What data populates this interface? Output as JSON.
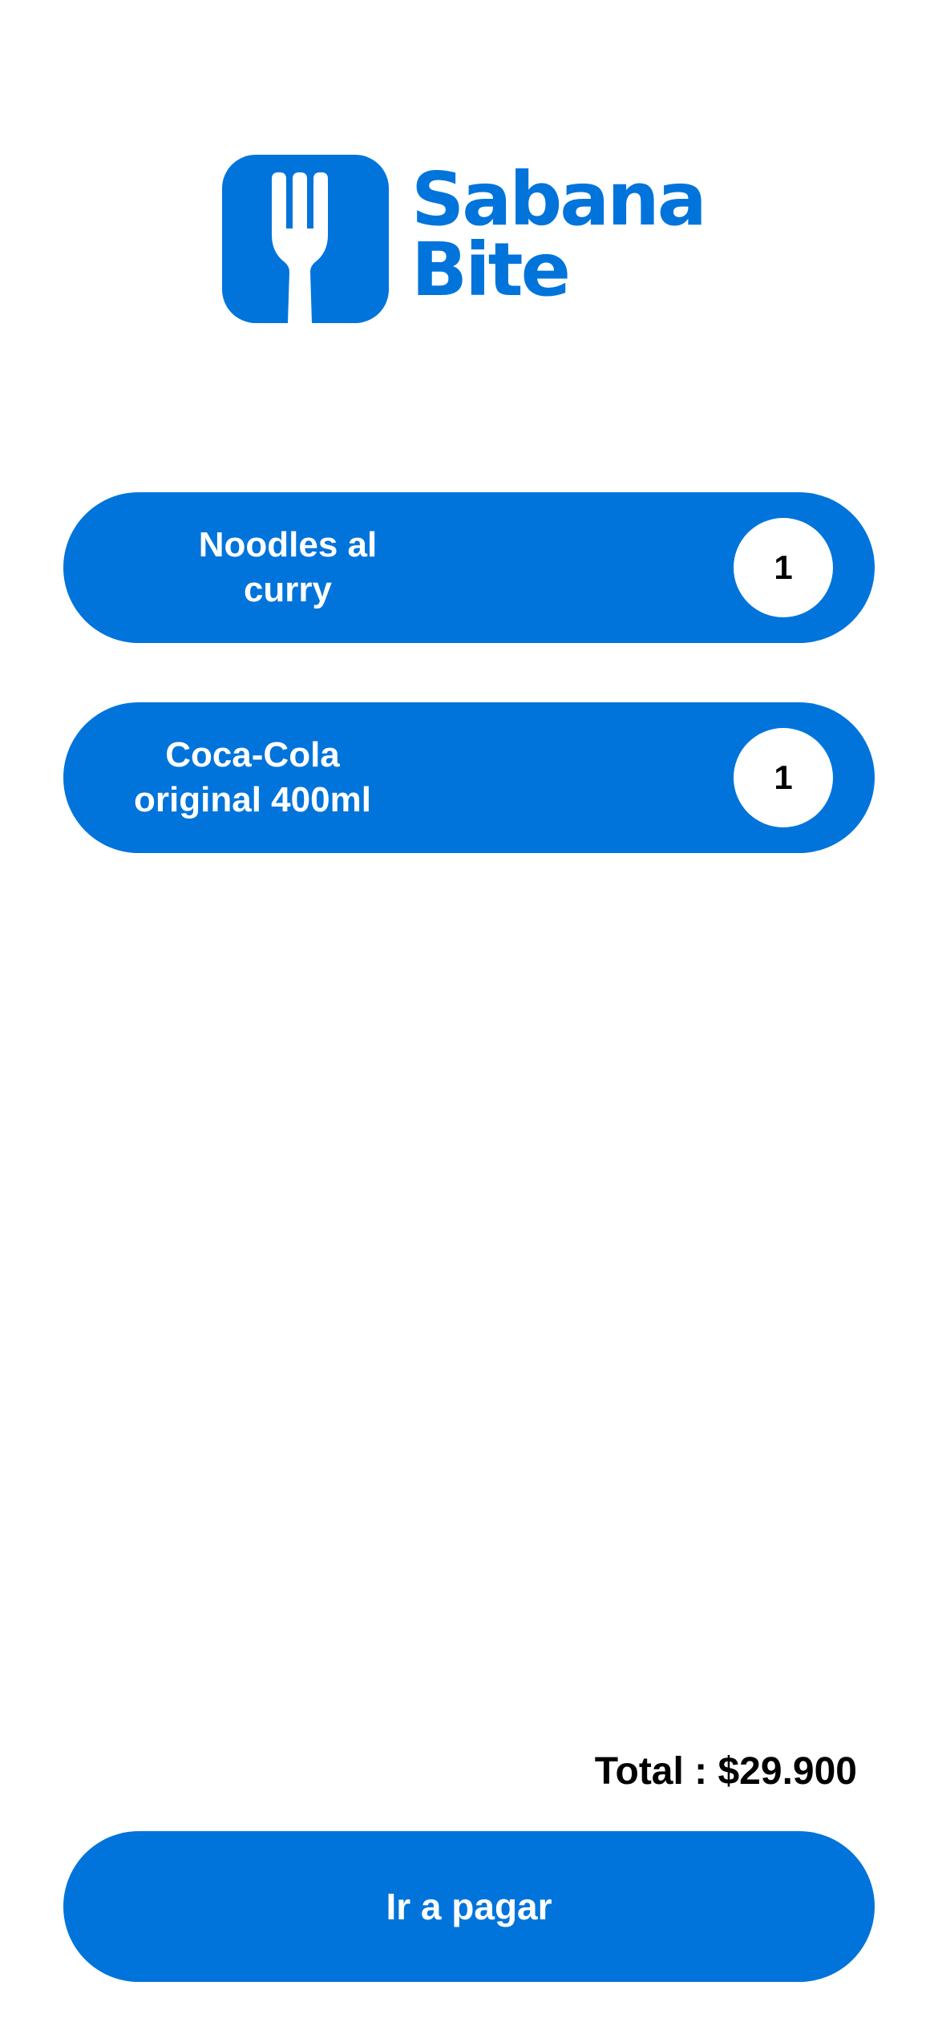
{
  "brand": {
    "name_line1": "Sabana",
    "name_line2": "Bite",
    "color": "#0074DB",
    "icon": "fork-icon"
  },
  "cart": {
    "items": [
      {
        "name_line1": "Noodles al",
        "name_line2": "curry",
        "quantity": "1"
      },
      {
        "name_line1": "Coca-Cola",
        "name_line2": "original 400ml",
        "quantity": "1"
      }
    ]
  },
  "summary": {
    "total_label": "Total : $29.900"
  },
  "actions": {
    "pay_label": "Ir a pagar"
  }
}
